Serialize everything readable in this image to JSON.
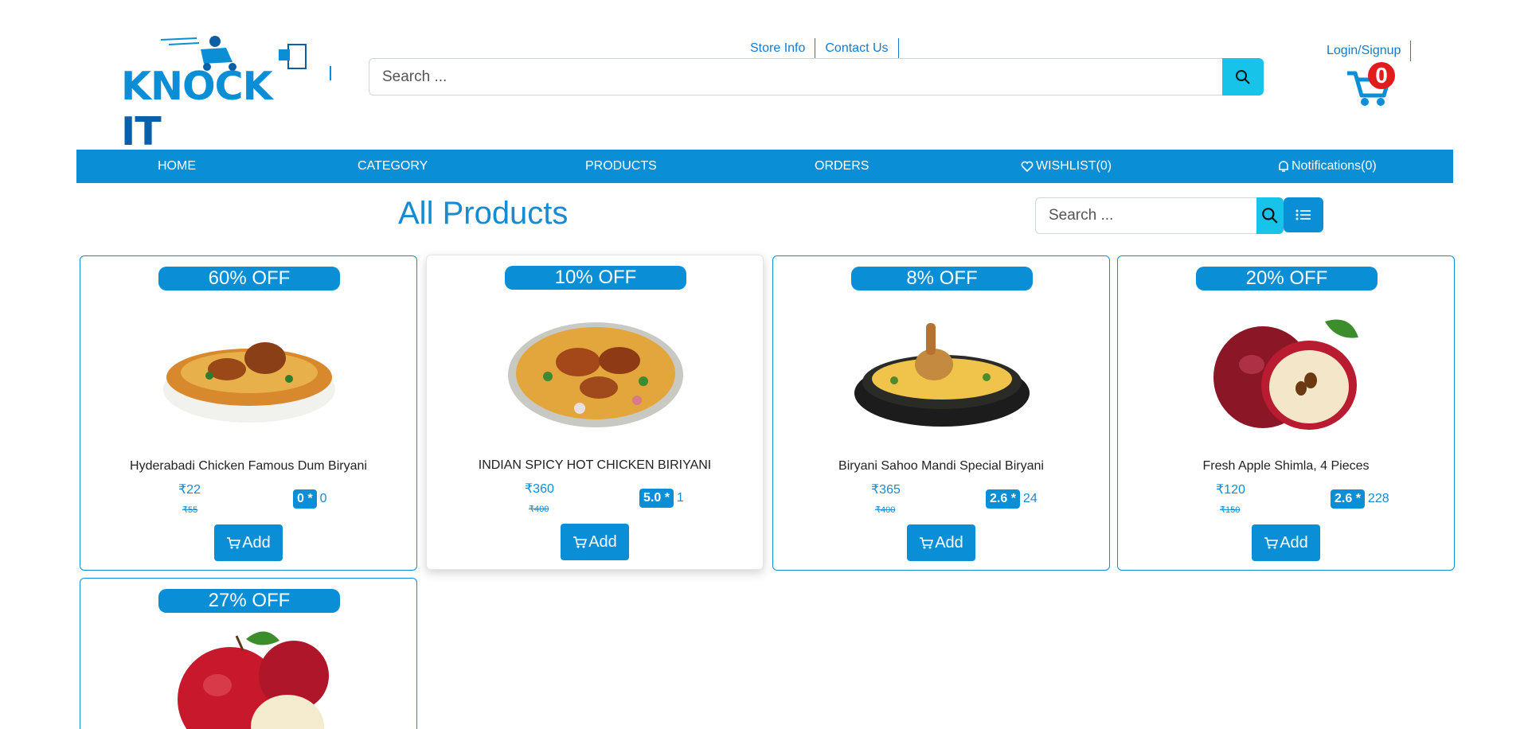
{
  "brand": {
    "logo_knock": "KNOCK",
    "logo_it": "IT"
  },
  "header": {
    "links": [
      {
        "label": "Store Info"
      },
      {
        "label": "Contact Us"
      }
    ],
    "search_placeholder": "Search ...",
    "login_label": "Login/Signup",
    "cart_count": "0"
  },
  "nav": {
    "items": [
      {
        "label": "HOME",
        "icon": ""
      },
      {
        "label": "CATEGORY",
        "icon": ""
      },
      {
        "label": "PRODUCTS",
        "icon": ""
      },
      {
        "label": "ORDERS",
        "icon": ""
      },
      {
        "label": "WISHLIST(0)",
        "icon": "heart-icon"
      },
      {
        "label": "Notifications(0)",
        "icon": "bell-icon"
      }
    ]
  },
  "main": {
    "title": "All Products",
    "search_placeholder": "Search ..."
  },
  "products": [
    {
      "discount": "60% OFF",
      "name": "Hyderabadi Chicken Famous Dum Biryani",
      "price": "₹22",
      "mrp": "₹55",
      "rating": "0 *",
      "rating_count": "0",
      "add_label": "Add",
      "image": "biryani-bowl"
    },
    {
      "discount": "10% OFF",
      "name": "INDIAN SPICY HOT CHICKEN BIRIYANI",
      "price": "₹360",
      "mrp": "₹400",
      "rating": "5.0 *",
      "rating_count": "1",
      "add_label": "Add",
      "image": "biryani-platter"
    },
    {
      "discount": "8% OFF",
      "name": "Biryani Sahoo Mandi Special Biryani",
      "price": "₹365",
      "mrp": "₹400",
      "rating": "2.6 *",
      "rating_count": "24",
      "add_label": "Add",
      "image": "biryani-handi"
    },
    {
      "discount": "20% OFF",
      "name": "Fresh Apple Shimla, 4 Pieces",
      "price": "₹120",
      "mrp": "₹150",
      "rating": "2.6 *",
      "rating_count": "228",
      "add_label": "Add",
      "image": "apple"
    },
    {
      "discount": "27% OFF",
      "name": "",
      "price": "",
      "mrp": "",
      "rating": "",
      "rating_count": "",
      "add_label": "",
      "image": "apples"
    }
  ],
  "colors": {
    "primary": "#0a8fd6",
    "search_button": "#17c3e8",
    "badge_red": "#e21b1b"
  }
}
